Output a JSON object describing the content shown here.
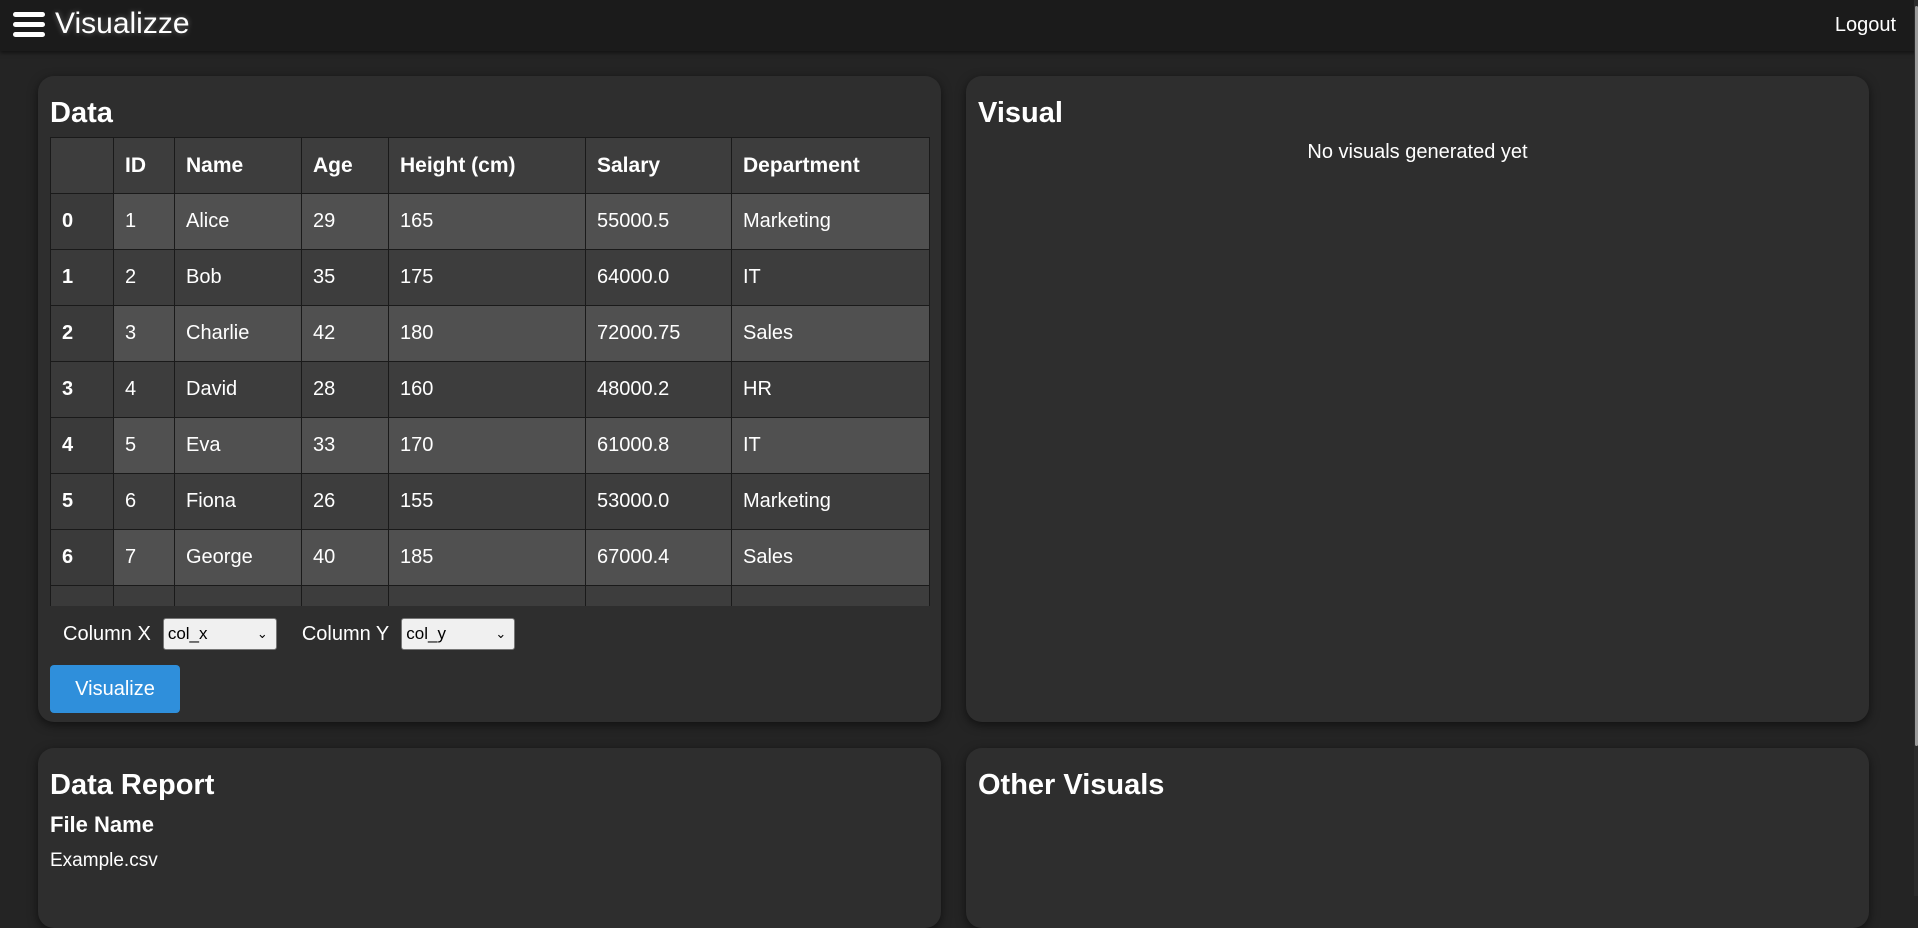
{
  "app": {
    "title": "Visualizze",
    "logout_label": "Logout"
  },
  "data_card": {
    "title": "Data",
    "table": {
      "headers": [
        "",
        "ID",
        "Name",
        "Age",
        "Height (cm)",
        "Salary",
        "Department"
      ],
      "rows": [
        [
          "0",
          "1",
          "Alice",
          "29",
          "165",
          "55000.5",
          "Marketing"
        ],
        [
          "1",
          "2",
          "Bob",
          "35",
          "175",
          "64000.0",
          "IT"
        ],
        [
          "2",
          "3",
          "Charlie",
          "42",
          "180",
          "72000.75",
          "Sales"
        ],
        [
          "3",
          "4",
          "David",
          "28",
          "160",
          "48000.2",
          "HR"
        ],
        [
          "4",
          "5",
          "Eva",
          "33",
          "170",
          "61000.8",
          "IT"
        ],
        [
          "5",
          "6",
          "Fiona",
          "26",
          "155",
          "53000.0",
          "Marketing"
        ],
        [
          "6",
          "7",
          "George",
          "40",
          "185",
          "67000.4",
          "Sales"
        ],
        [
          "",
          "",
          "",
          "",
          "",
          "",
          ""
        ]
      ]
    },
    "column_x": {
      "label": "Column X",
      "selected": "col_x"
    },
    "column_y": {
      "label": "Column Y",
      "selected": "col_y"
    },
    "visualize_label": "Visualize"
  },
  "visual_card": {
    "title": "Visual",
    "empty_message": "No visuals generated yet"
  },
  "report_card": {
    "title": "Data Report",
    "file_name_label": "File Name",
    "file_name_value": "Example.csv"
  },
  "other_card": {
    "title": "Other Visuals"
  },
  "colors": {
    "background": "#242424",
    "topbar": "#1b1b1b",
    "card": "#2e2e2e",
    "accent": "#2f8fdb"
  }
}
